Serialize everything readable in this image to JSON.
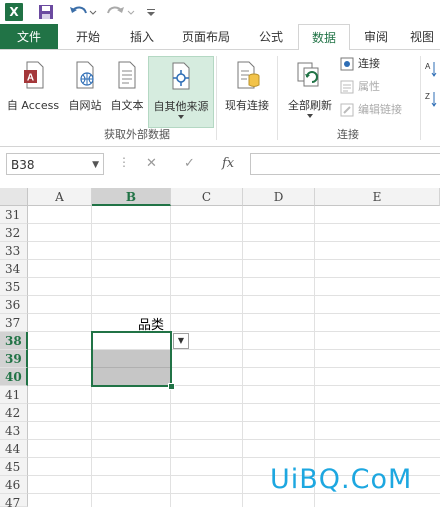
{
  "qat": {
    "logo_text": "X"
  },
  "tabs": [
    {
      "label": "文件"
    },
    {
      "label": "开始"
    },
    {
      "label": "插入"
    },
    {
      "label": "页面布局"
    },
    {
      "label": "公式"
    },
    {
      "label": "数据"
    },
    {
      "label": "审阅"
    },
    {
      "label": "视图"
    }
  ],
  "active_tab": "数据",
  "ribbon": {
    "external_group": {
      "label": "获取外部数据",
      "buttons": [
        {
          "label": "自 Access"
        },
        {
          "label": "自网站"
        },
        {
          "label": "自文本"
        },
        {
          "label": "自其他来源"
        }
      ]
    },
    "existing_connections": {
      "label": "现有连接"
    },
    "connections_group": {
      "label": "连接",
      "refresh_all": "全部刷新",
      "small": [
        {
          "label": "连接"
        },
        {
          "label": "属性"
        },
        {
          "label": "编辑链接"
        }
      ]
    }
  },
  "formula_bar": {
    "name_box": "B38",
    "fx": "fx",
    "value": ""
  },
  "grid": {
    "columns": [
      "A",
      "B",
      "C",
      "D",
      "E"
    ],
    "selected_column": "B",
    "rows": [
      "31",
      "32",
      "33",
      "34",
      "35",
      "36",
      "37",
      "38",
      "39",
      "40",
      "41",
      "42",
      "43",
      "44",
      "45",
      "46",
      "47"
    ],
    "selected_rows": [
      "38",
      "39",
      "40"
    ],
    "cells": {
      "B37": "品类"
    }
  },
  "watermark": "UiBQ.CoM",
  "colors": {
    "accent": "#217346",
    "selection_fill": "#c6c6c6",
    "watermark": "#1da7e0"
  }
}
